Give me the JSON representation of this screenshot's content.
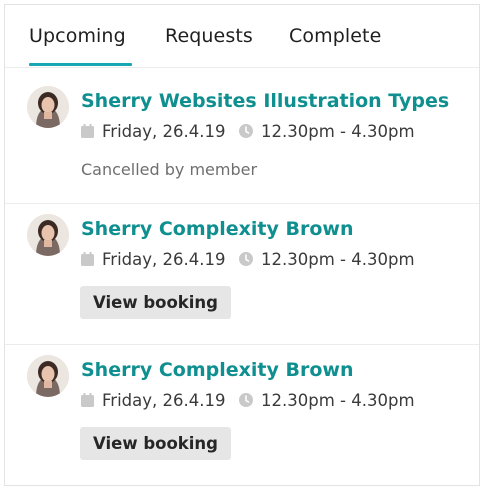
{
  "tabs": [
    {
      "label": "Upcoming",
      "active": true
    },
    {
      "label": "Requests",
      "active": false
    },
    {
      "label": "Complete",
      "active": false
    }
  ],
  "accent_color": "#17a8b4",
  "title_color": "#0f8f8f",
  "bookings": [
    {
      "title": "Sherry Websites Illustration Types",
      "date": "Friday, 26.4.19",
      "time": "12.30pm - 4.30pm",
      "status": "Cancelled by member",
      "icons": {
        "date": "calendar-icon",
        "time": "clock-icon"
      }
    },
    {
      "title": "Sherry Complexity Brown",
      "date": "Friday, 26.4.19",
      "time": "12.30pm - 4.30pm",
      "action_label": "View booking",
      "icons": {
        "date": "calendar-icon",
        "time": "clock-icon"
      }
    },
    {
      "title": "Sherry Complexity Brown",
      "date": "Friday, 26.4.19",
      "time": "12.30pm - 4.30pm",
      "action_label": "View booking",
      "icons": {
        "date": "calendar-icon",
        "time": "clock-icon"
      }
    }
  ]
}
